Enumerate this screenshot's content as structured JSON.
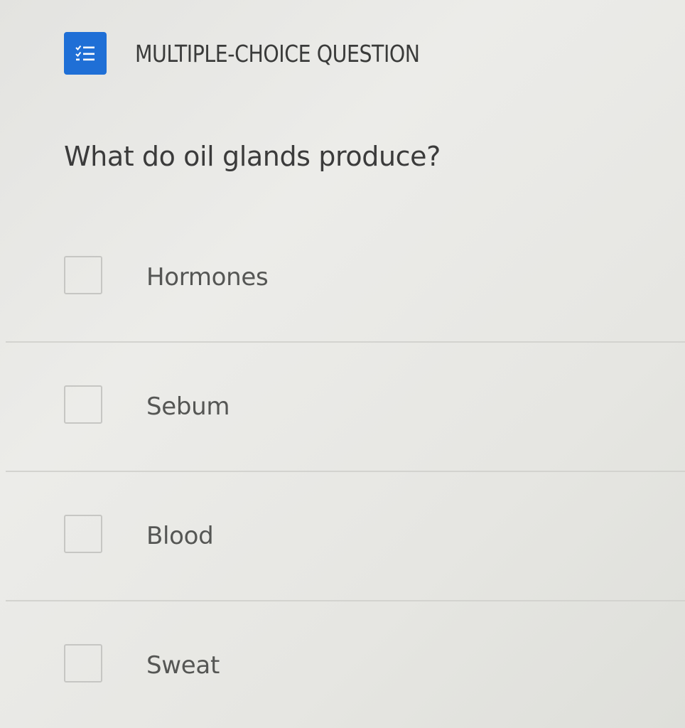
{
  "header": {
    "icon": "checklist-icon",
    "icon_color": "#1f6fd6",
    "title": "MULTIPLE-CHOICE QUESTION"
  },
  "question": {
    "text": "What do oil glands produce?"
  },
  "options": [
    {
      "label": "Hormones",
      "checked": false
    },
    {
      "label": "Sebum",
      "checked": false
    },
    {
      "label": "Blood",
      "checked": false
    },
    {
      "label": "Sweat",
      "checked": false
    }
  ]
}
